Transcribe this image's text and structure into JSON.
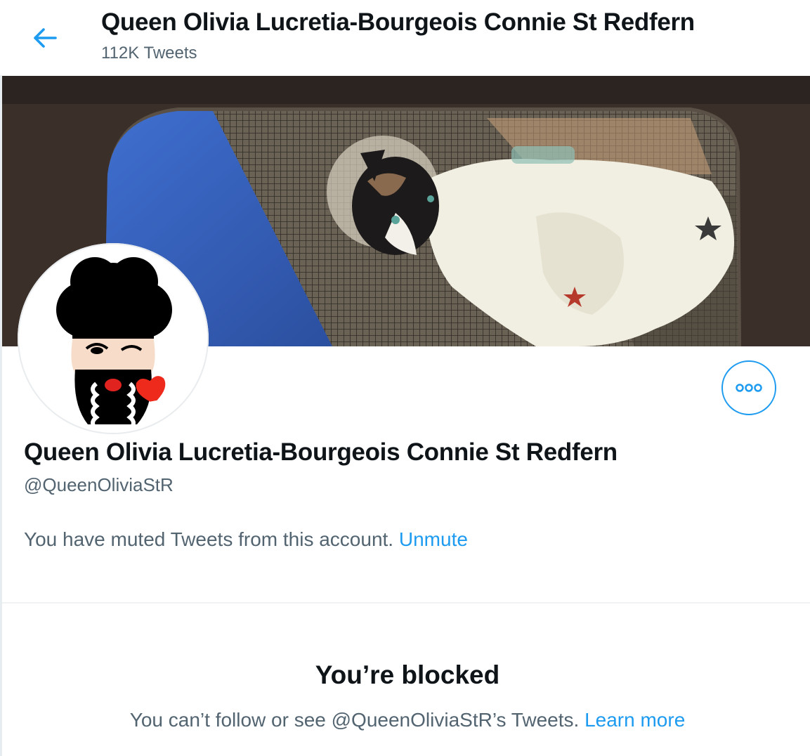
{
  "header": {
    "title": "Queen Olivia Lucretia-Bourgeois Connie St Redfern",
    "tweet_count": "112K Tweets"
  },
  "profile": {
    "display_name": "Queen Olivia Lucretia-Bourgeois Connie St Redfern",
    "handle": "@QueenOliviaStR",
    "muted_text": "You have muted Tweets from this account.",
    "unmute_label": "Unmute"
  },
  "blocked": {
    "title": "You’re blocked",
    "description": "You can’t follow or see @QueenOliviaStR’s Tweets.",
    "learn_more_label": "Learn more"
  },
  "icons": {
    "back": "arrow-left-icon",
    "more": "more-options-icon"
  },
  "colors": {
    "accent": "#1d9bf0",
    "secondary_text": "#536471",
    "primary_text": "#0f1419"
  }
}
